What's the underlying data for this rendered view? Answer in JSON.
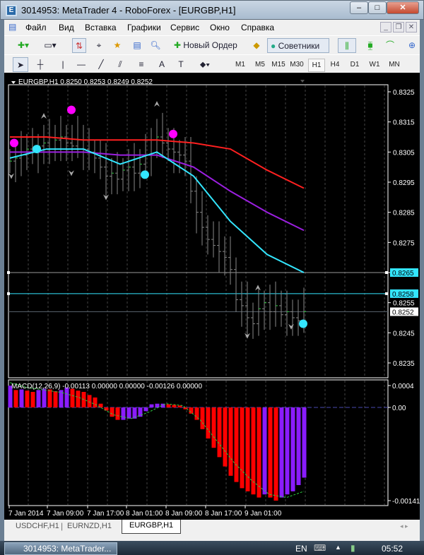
{
  "window": {
    "title": "3014953: MetaTrader 4 - RoboForex - [EURGBP,H1]"
  },
  "menu": [
    "Файл",
    "Вид",
    "Вставка",
    "Графики",
    "Сервис",
    "Окно",
    "Справка"
  ],
  "toolbar": {
    "new_order": "Новый Ордер",
    "experts": "Советники"
  },
  "drawing_tools": {
    "text": "A"
  },
  "timeframes": [
    "M1",
    "M5",
    "M15",
    "M30",
    "H1",
    "H4",
    "D1",
    "W1",
    "MN"
  ],
  "selected_timeframe": "H1",
  "chart": {
    "header": "EURGBP,H1  0.8250 0.8253 0.8249 0.8252",
    "price_ticks": [
      "0.8325",
      "0.8315",
      "0.8305",
      "0.8295",
      "0.8285",
      "0.8275",
      "0.8265",
      "0.8255",
      "0.8245",
      "0.8235"
    ],
    "line_labels": {
      "gray": "0.8265",
      "cyan": "0.8258",
      "bid": "0.8252"
    },
    "macd_header": "MACD(12,26,9) -0.00113 0.00000 0.00000 -0.00126 0.00000",
    "macd_ticks": [
      "0.0004",
      "0.00",
      "-0.00141"
    ],
    "time_ticks": [
      "7 Jan 2014",
      "7 Jan 09:00",
      "7 Jan 17:00",
      "8 Jan 01:00",
      "8 Jan 09:00",
      "8 Jan 17:00",
      "9 Jan 01:00"
    ],
    "colors": {
      "bg": "#000000",
      "ma_slow": "#ff2020",
      "ma_mid": "#9b1fe0",
      "ma_fast": "#33e6ff",
      "dot_up": "#ff00ff",
      "dot_down": "#33e6ff",
      "macd_down": "#ff0000",
      "macd_up": "#8a1cff",
      "signal": "#2ecc40"
    }
  },
  "chart_data": {
    "type": "line",
    "closes": [
      0.8302,
      0.8303,
      0.8304,
      0.8306,
      0.8305,
      0.8307,
      0.8308,
      0.8306,
      0.8309,
      0.831,
      0.8308,
      0.8307,
      0.8309,
      0.8306,
      0.8305,
      0.8303,
      0.83,
      0.8297,
      0.8298,
      0.8296,
      0.8299,
      0.83,
      0.8298,
      0.8301,
      0.8304,
      0.8309,
      0.831,
      0.8308,
      0.8306,
      0.8305,
      0.8304,
      0.8302,
      0.8292,
      0.8285,
      0.828,
      0.8276,
      0.8274,
      0.8272,
      0.827,
      0.8266,
      0.8256,
      0.8254,
      0.825,
      0.8248,
      0.8253,
      0.8255,
      0.8252,
      0.8254,
      0.8251,
      0.8252,
      0.825,
      0.8249,
      0.8252
    ],
    "ma_slow": [
      0.831,
      0.831,
      0.8309,
      0.8309,
      0.8309,
      0.8308,
      0.8306,
      0.8299,
      0.8293
    ],
    "ma_mid": [
      0.8305,
      0.8305,
      0.8305,
      0.8304,
      0.8304,
      0.83,
      0.8292,
      0.8285,
      0.8279
    ],
    "ma_fast": [
      0.8303,
      0.8306,
      0.8306,
      0.8301,
      0.8305,
      0.8297,
      0.8282,
      0.8271,
      0.8265
    ],
    "macd_hist": [
      0.00035,
      0.00028,
      0.00029,
      0.00027,
      0.00025,
      0.00028,
      0.0003,
      0.00029,
      0.00026,
      0.00028,
      0.00032,
      0.0003,
      0.00027,
      0.00025,
      0.0002,
      0.00016,
      6e-05,
      -5e-05,
      -0.00015,
      -0.0002,
      -0.0002,
      -0.00018,
      -0.00018,
      -0.00015,
      -6e-05,
      5e-05,
      6e-05,
      6e-05,
      5e-05,
      4e-05,
      3e-05,
      -3e-05,
      -0.0001,
      -0.0002,
      -0.00035,
      -0.0005,
      -0.00065,
      -0.0008,
      -0.00095,
      -0.0011,
      -0.0012,
      -0.0013,
      -0.00135,
      -0.0014,
      -0.00145,
      -0.0014,
      -0.00145,
      -0.0015,
      -0.00145,
      -0.0014,
      -0.00135,
      -0.00125,
      -0.00113
    ],
    "signal": [
      0.0004,
      0.00032,
      0.00028,
      0.00024,
      0.00016,
      4e-05,
      -0.00012,
      -0.00018,
      -8e-05,
      6e-05,
      3e-05,
      -0.0002,
      -0.00055,
      -0.0009,
      -0.00118,
      -0.0014,
      -0.00145,
      -0.00135
    ],
    "ylim": [
      0.823,
      0.8328
    ]
  },
  "tabs": [
    "USDCHF,H1",
    "EURNZD,H1",
    "EURGBP,H1"
  ],
  "active_tab": "EURGBP,H1",
  "taskbar": {
    "app": "3014953: MetaTrader...",
    "lang": "EN",
    "clock": "05:52"
  }
}
